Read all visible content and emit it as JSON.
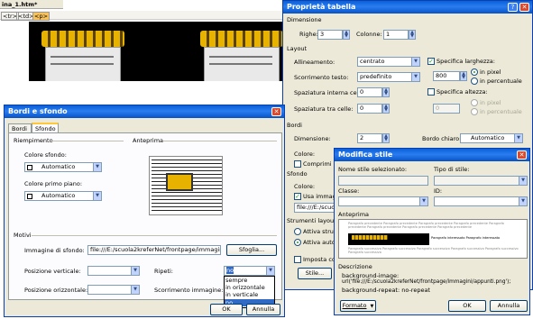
{
  "editor": {
    "file_tab": "ina_1.htm*",
    "tags": [
      "<tr>",
      "<td>",
      "<p>"
    ]
  },
  "table_props": {
    "title": "Proprietà tabella",
    "sec_size": "Dimensione",
    "rows_label": "Righe:",
    "rows_value": "3",
    "cols_label": "Colonne:",
    "cols_value": "1",
    "sec_layout": "Layout",
    "align_label": "Allineamento:",
    "align_value": "centrato",
    "width_chk": "Specifica larghezza:",
    "width_value": "800",
    "in_pixel": "in pixel",
    "in_percent": "in percentuale",
    "scroll_label": "Scorrimento testo:",
    "scroll_value": "predefinito",
    "height_chk": "Specifica altezza:",
    "height_value": "0",
    "in_pixel2": "in pixel",
    "in_percent2": "in percentuale",
    "padding_label": "Spaziatura interna celle:",
    "padding_value": "0",
    "spacing_label": "Spaziatura tra celle:",
    "spacing_value": "0",
    "sec_borders": "Bordi",
    "bsize_label": "Dimensione:",
    "bsize_value": "2",
    "light_label": "Bordo chiaro:",
    "light_value": "Automatico",
    "color_label": "Colore:",
    "collapse_chk": "Comprimi bor",
    "sec_bg": "Sfondo",
    "bg_color_label": "Colore:",
    "use_image_chk": "Usa immagine d",
    "file_path": "file:///E:/scuola2",
    "sec_tools": "Strumenti layout",
    "radio1": "Attiva strumen",
    "radio2": "Attiva automat",
    "default_chk": "Imposta come",
    "style_btn": "Stile..."
  },
  "bordi_sfondo": {
    "title": "Bordi e sfondo",
    "tab1": "Bordi",
    "tab2": "Sfondo",
    "sec_fill": "Riempimento",
    "bg_color_label": "Colore sfondo:",
    "bg_color_value": "Automatico",
    "fg_color_label": "Colore primo piano:",
    "fg_color_value": "Automatico",
    "preview_label": "Anteprima",
    "sec_patterns": "Motivi",
    "image_label": "Immagine di sfondo:",
    "image_value": "file:///E:/scuola2kreferNet/frontpage/immagini/appunt",
    "browse_btn": "Sfoglia...",
    "vpos_label": "Posizione verticale:",
    "hpos_label": "Posizione orizzontale:",
    "repeat_label": "Ripeti:",
    "repeat_value": "no",
    "scroll_label": "Scorrimento immagine:",
    "repeat_options": [
      "sempre",
      "in orizzontale",
      "in verticale",
      "no"
    ],
    "ok_btn": "OK",
    "cancel_btn": "Annulla"
  },
  "modifica_stile": {
    "title": "Modifica stile",
    "name_label": "Nome stile selezionato:",
    "type_label": "Tipo di stile:",
    "class_label": "Classe:",
    "id_label": "ID:",
    "preview_label": "Anteprima",
    "preview_text": "Paragrafo precedente Paragrafo precedente Paragrafo precedente Paragrafo precedente Paragrafo precedente Paragrafo precedente Paragrafo precedente Paragrafo precedente",
    "preview_inline": "Paragrafo interessato Paragrafo interessato",
    "preview_next": "Paragrafo successivo Paragrafo successivo Paragrafo successivo Paragrafo successivo Paragrafo successivo Paragrafo successivo",
    "desc_label": "Descrizione",
    "desc_line1": "background-image:",
    "desc_line2": "url('file:///E:/scuola2kreferNet/frontpage/immagini/appunti.png');",
    "desc_line3": "background-repeat: no-repeat",
    "format_btn": "Formato",
    "ok_btn": "OK",
    "cancel_btn": "Annulla"
  },
  "colors": {
    "title_bar": "#0a5fd8",
    "dialog_bg": "#ece9d8",
    "image_bg": "#000000",
    "image_gold": "#e7b300"
  }
}
